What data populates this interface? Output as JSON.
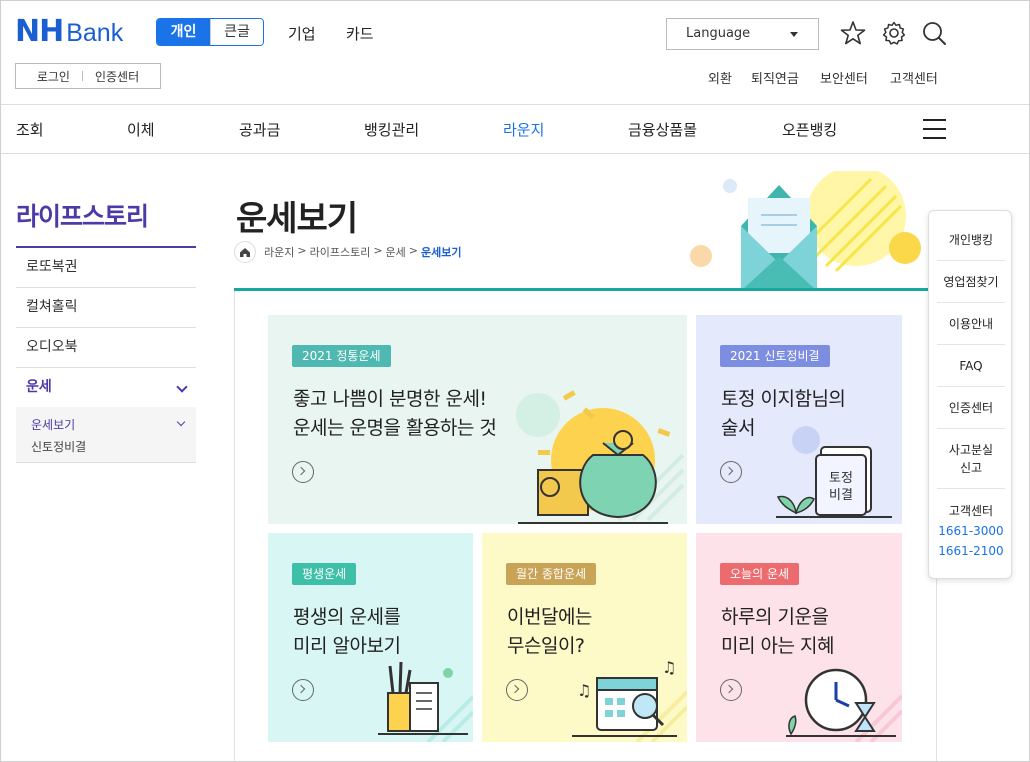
{
  "header": {
    "logo_nh": "NH",
    "logo_bank": "Bank",
    "mode_personal": "개인",
    "mode_large": "큰글",
    "nav": [
      "기업",
      "카드"
    ],
    "login": "로그인",
    "cert": "인증센터",
    "language": "Language",
    "util_links": [
      "외환",
      "퇴직연금",
      "보안센터",
      "고객센터"
    ]
  },
  "gnb": [
    "조회",
    "이체",
    "공과금",
    "뱅킹관리",
    "라운지",
    "금융상품몰",
    "오픈뱅킹"
  ],
  "lnb": {
    "title": "라이프스토리",
    "items": [
      "로또복권",
      "컬쳐홀릭",
      "오디오북",
      "운세"
    ],
    "sub_active": "운세보기",
    "sub_other": "신토정비결"
  },
  "page": {
    "title": "운세보기",
    "breadcrumb": [
      "라운지",
      "라이프스토리",
      "운세",
      "운세보기"
    ]
  },
  "cards": [
    {
      "tag": "2021 정통운세",
      "line1": "좋고 나쁨이 분명한 운세!",
      "line2": "운세는 운명을 활용하는 것",
      "tag_color": "#4fb8b0",
      "bg": "#e8f5f0"
    },
    {
      "tag": "2021 신토정비결",
      "line1": "토정 이지함님의",
      "line2": "술서",
      "tag_color": "#7d8ee0",
      "bg": "#e4e9fb"
    },
    {
      "tag": "평생운세",
      "line1": "평생의 운세를",
      "line2": "미리 알아보기",
      "tag_color": "#3dbfa8",
      "bg": "#d8f6f4"
    },
    {
      "tag": "월간 종합운세",
      "line1": "이번달에는",
      "line2": "무슨일이?",
      "tag_color": "#c9a356",
      "bg": "#fdfac8"
    },
    {
      "tag": "오늘의 운세",
      "line1": "하루의 기운을",
      "line2": "미리 아는 지혜",
      "tag_color": "#ec6b6e",
      "bg": "#fde2ea"
    }
  ],
  "quick": {
    "items": [
      "개인뱅킹",
      "영업점찾기",
      "이용안내",
      "FAQ"
    ],
    "cert": "인증센터",
    "lost1": "사고분실",
    "lost2": "신고",
    "cs": "고객센터",
    "tel1": "1661-3000",
    "tel2": "1661-2100"
  },
  "icons": [
    "star-icon",
    "gear-icon",
    "search-icon",
    "menu-icon",
    "home-icon"
  ]
}
